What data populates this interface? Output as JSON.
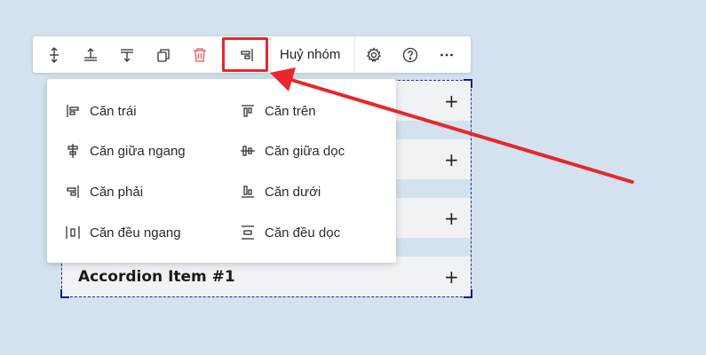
{
  "accordion": {
    "items": [
      {
        "title": ""
      },
      {
        "title": ""
      },
      {
        "title": ""
      },
      {
        "title": "Accordion Item #1"
      }
    ],
    "plus": "+"
  },
  "toolbar": {
    "ungroup_label": "Huỷ nhóm",
    "more_label": "···",
    "icons": [
      "move-vertical-icon",
      "move-up-icon",
      "move-down-icon",
      "duplicate-icon",
      "delete-icon",
      "align-right-icon",
      "settings-icon",
      "help-icon",
      "more-icon"
    ],
    "delete_color": "#e05a5a",
    "highlight_color": "#e8262b"
  },
  "align_menu": {
    "left_column": [
      {
        "label": "Căn trái",
        "icon": "align-left-icon"
      },
      {
        "label": "Căn giữa ngang",
        "icon": "align-center-horizontal-icon"
      },
      {
        "label": "Căn phải",
        "icon": "align-right-icon"
      },
      {
        "label": "Căn đều ngang",
        "icon": "distribute-horizontal-icon"
      }
    ],
    "right_column": [
      {
        "label": "Căn trên",
        "icon": "align-top-icon"
      },
      {
        "label": "Căn giữa dọc",
        "icon": "align-center-vertical-icon"
      },
      {
        "label": "Căn dưới",
        "icon": "align-bottom-icon"
      },
      {
        "label": "Căn đều dọc",
        "icon": "distribute-vertical-icon"
      }
    ]
  }
}
